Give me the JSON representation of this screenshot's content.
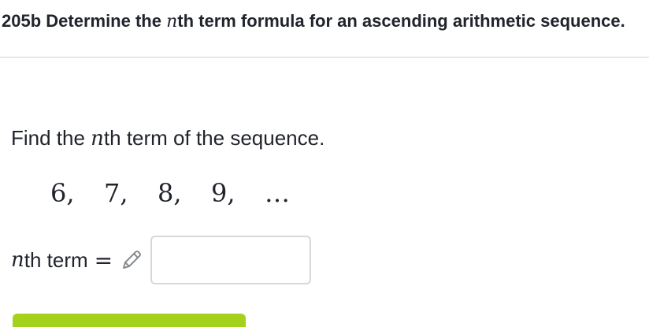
{
  "header": {
    "title_prefix": "205b Determine the ",
    "title_var": "n",
    "title_suffix": "th term formula for an ascending arithmetic sequence."
  },
  "question": {
    "prompt_prefix": "Find the ",
    "prompt_var": "n",
    "prompt_suffix": "th term of the sequence.",
    "sequence_terms": [
      "6,",
      "7,",
      "8,",
      "9,"
    ],
    "sequence_ellipsis": "…"
  },
  "answer": {
    "label_var": "n",
    "label_suffix": "th term",
    "equals": "=",
    "value": ""
  },
  "colors": {
    "accent_green": "#a4d11c",
    "text": "#21242c",
    "divider": "#cfd1d4"
  },
  "icons": {
    "edit": "pencil-icon"
  }
}
